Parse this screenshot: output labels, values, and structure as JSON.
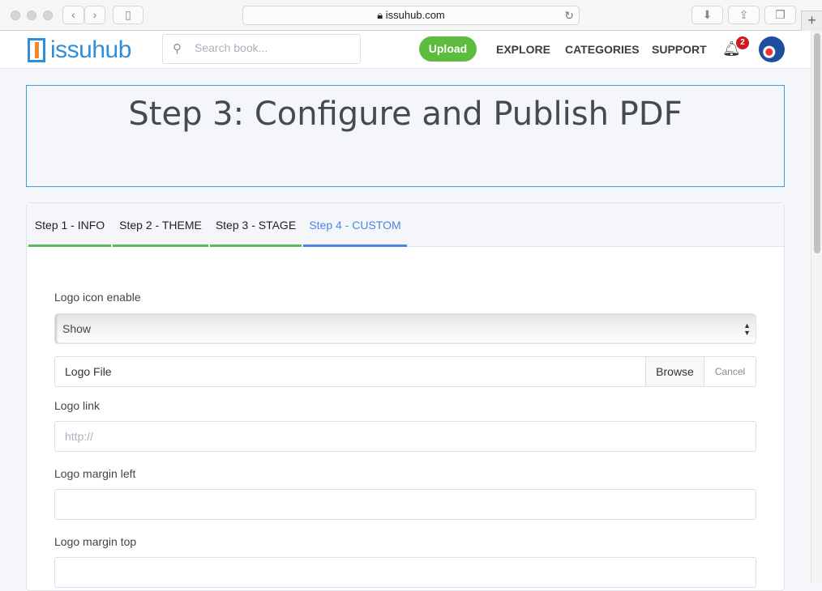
{
  "browser": {
    "url": "issuhub.com",
    "lock_icon": "lock-icon",
    "reload_icon": "reload-icon"
  },
  "header": {
    "logo_text": "issuhub",
    "search_placeholder": "Search book...",
    "upload": "Upload",
    "nav": [
      "EXPLORE",
      "CATEGORIES",
      "SUPPORT"
    ],
    "notification_count": "2"
  },
  "page": {
    "title": "Step 3: Configure and Publish PDF"
  },
  "tabs": [
    {
      "label": "Step 1 - INFO"
    },
    {
      "label": "Step 2 - THEME"
    },
    {
      "label": "Step 3 - STAGE"
    },
    {
      "label": "Step 4 - CUSTOM",
      "active": true
    }
  ],
  "form": {
    "logo_icon_enable": {
      "label": "Logo icon enable",
      "value": "Show"
    },
    "logo_file": {
      "placeholder": "Logo File",
      "browse": "Browse",
      "cancel": "Cancel"
    },
    "logo_link": {
      "label": "Logo link",
      "placeholder": "http://",
      "value": ""
    },
    "logo_margin_left": {
      "label": "Logo margin left",
      "value": ""
    },
    "logo_margin_top": {
      "label": "Logo margin top",
      "value": ""
    }
  },
  "colors": {
    "accent": "#4a86e8",
    "complete": "#5cb85c",
    "upload": "#5dbb3e",
    "brand": "#2e8fd8"
  }
}
